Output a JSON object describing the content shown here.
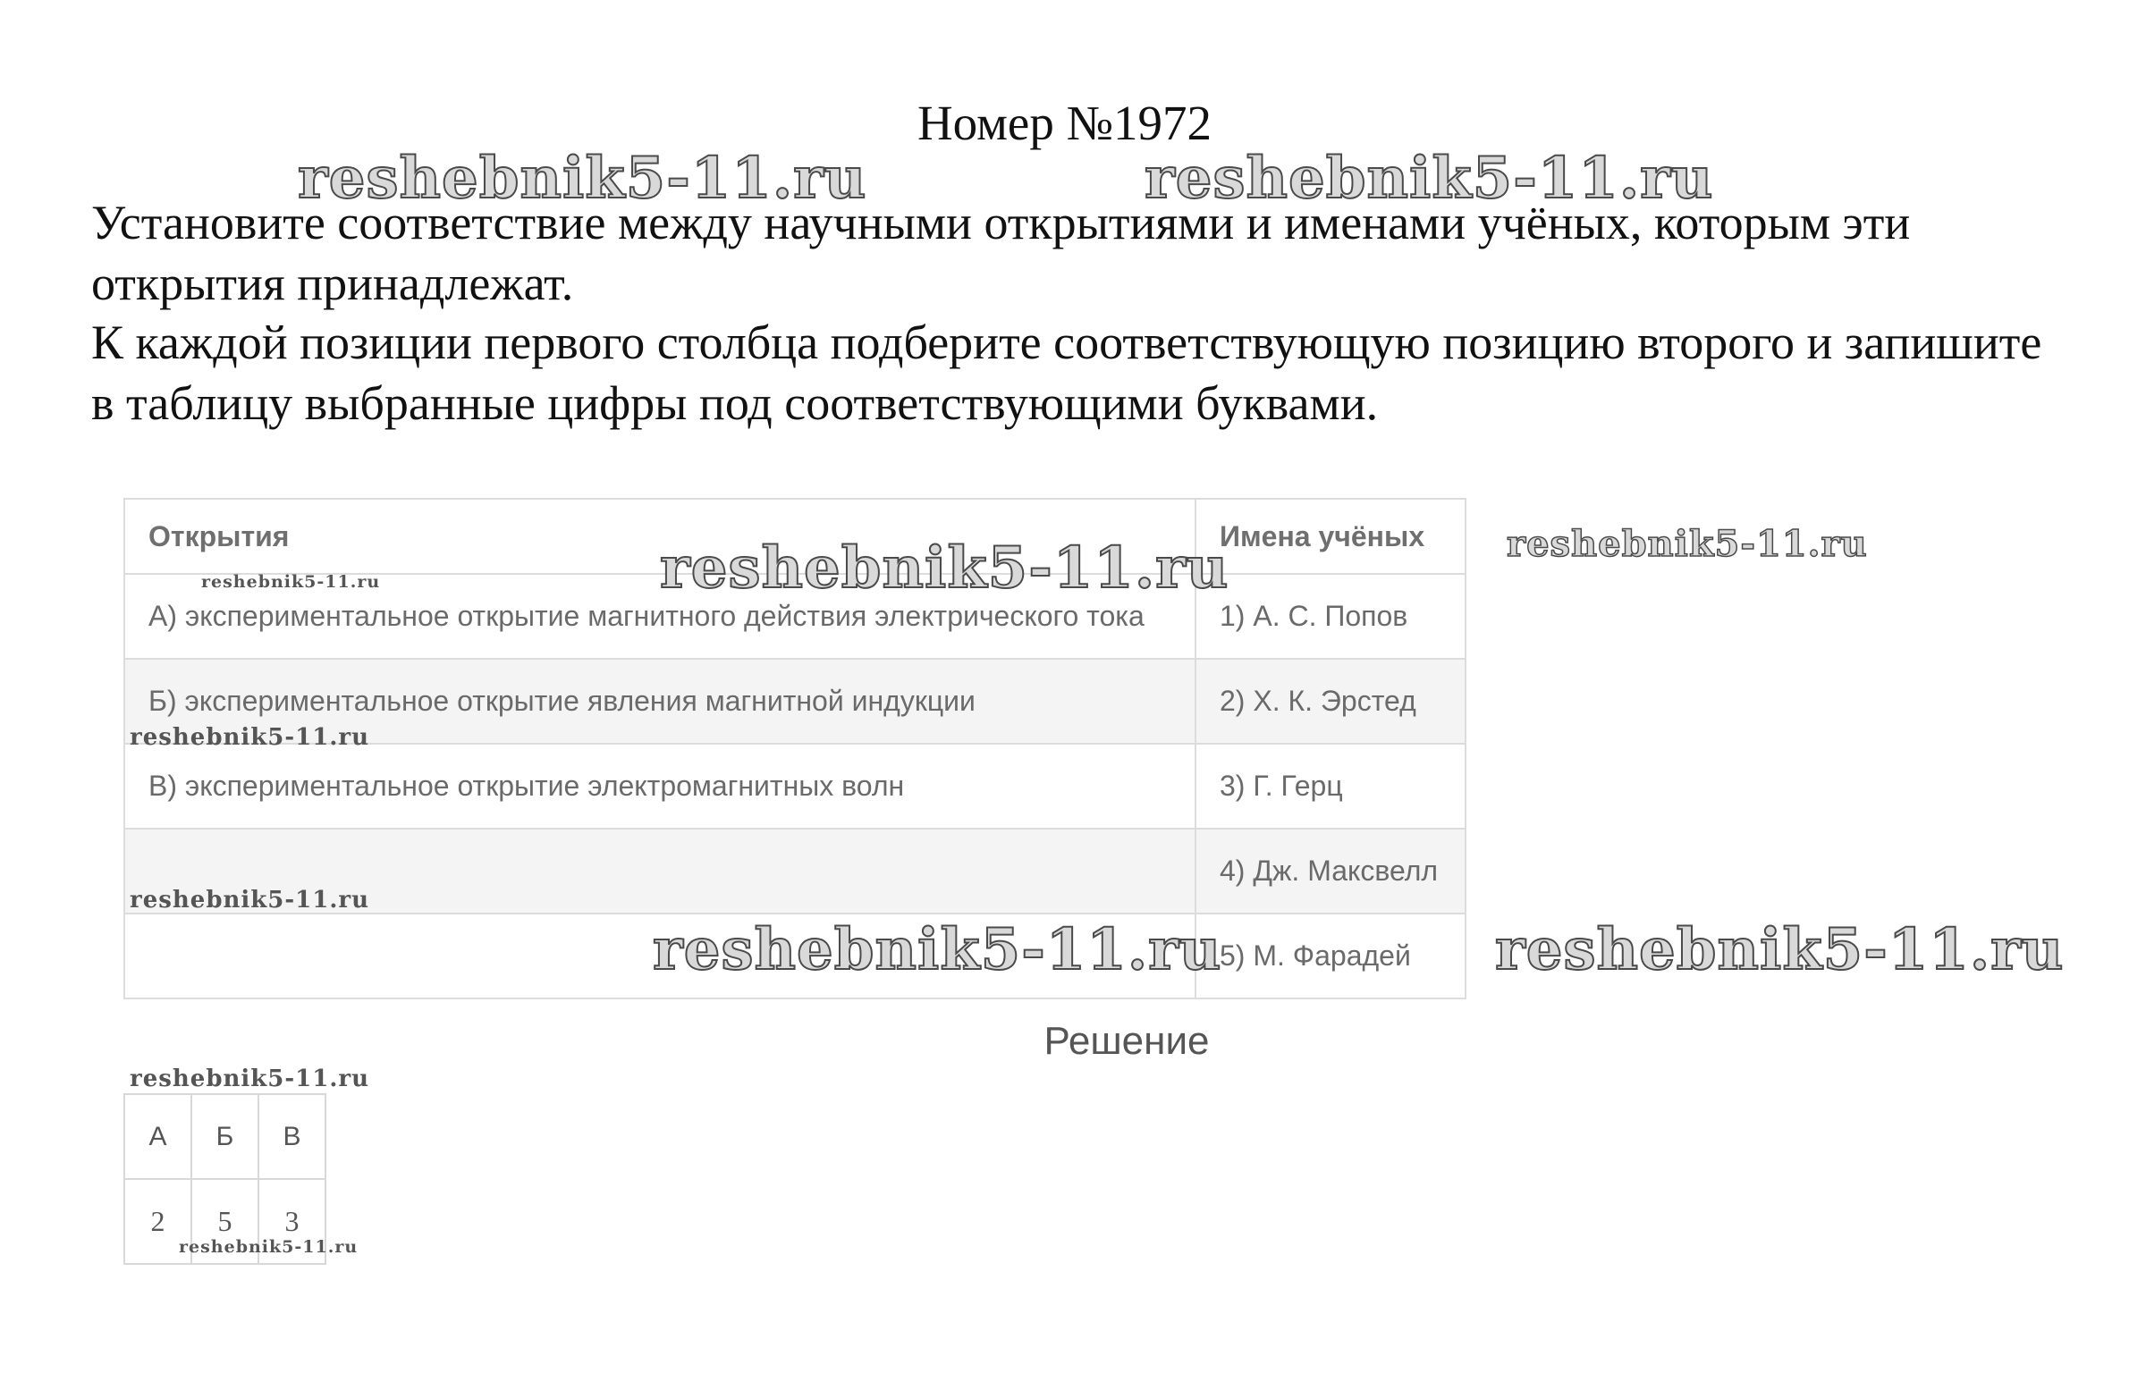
{
  "title": "Номер №1972",
  "task": {
    "paragraph1": "Установите соответствие между научными открытиями и именами учёных, которым эти открытия принадлежат.",
    "paragraph2": "К каждой позиции первого столбца подберите соответствующую позицию второго и запишите в таблицу выбранные цифры под соответствующими буквами."
  },
  "match_table": {
    "headers": [
      "Открытия",
      "Имена учёных"
    ],
    "rows": [
      {
        "left": "А) экспериментальное открытие магнитного действия электрического тока",
        "right": "1) А. С. Попов"
      },
      {
        "left": "Б) экспериментальное открытие явления магнитной индукции",
        "right": "2) Х. К. Эрстед"
      },
      {
        "left": "В) экспериментальное открытие электромагнитных волн",
        "right": "3) Г. Герц"
      },
      {
        "left": "",
        "right": "4) Дж. Максвелл"
      },
      {
        "left": "",
        "right": "5) М. Фарадей"
      }
    ]
  },
  "solution": {
    "title": "Решение",
    "letters": [
      "А",
      "Б",
      "В"
    ],
    "answers": [
      "2",
      "5",
      "3"
    ]
  },
  "watermark": "reshebnik5-11.ru"
}
